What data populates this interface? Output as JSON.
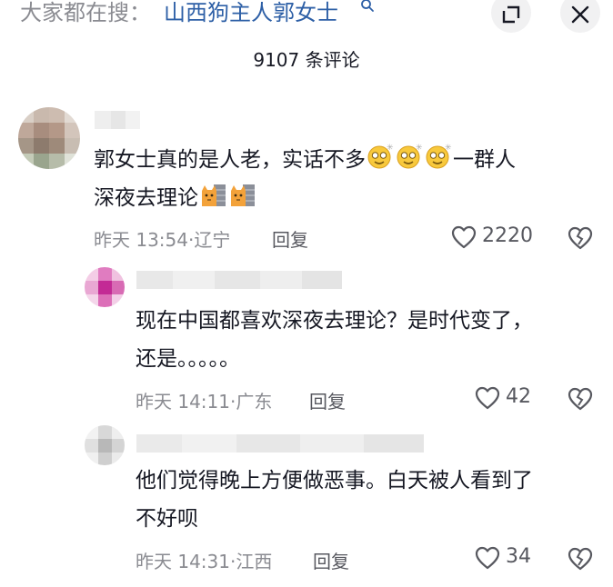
{
  "header": {
    "search_prefix": "大家都在搜：",
    "search_term": "山西狗主人郭女士",
    "expand_button": "expand-icon",
    "close_button": "close-icon"
  },
  "comments_count_label": "9107 条评论",
  "comments": [
    {
      "text_line1": "郭女士真的是人老，实话不多",
      "text_line1_tail": "一群人",
      "text_line2": "深夜去理论",
      "emojis": [
        "dizzy-face-emoji",
        "dizzy-face-emoji",
        "dizzy-face-emoji",
        "cat-wall-emoji",
        "cat-wall-emoji"
      ],
      "time": "昨天 13:54",
      "location": "辽宁",
      "reply_label": "回复",
      "likes": "2220"
    },
    {
      "text_line1": "现在中国都喜欢深夜去理论？是时代变了，",
      "text_line2": "还是。。。。。",
      "time": "昨天 14:11",
      "location": "广东",
      "reply_label": "回复",
      "likes": "42"
    },
    {
      "text_line1": "他们觉得晚上方便做恶事。白天被人看到了",
      "text_line2": "不好呗",
      "time": "昨天 14:31",
      "location": "江西",
      "reply_label": "回复",
      "likes": "34"
    }
  ],
  "colors": {
    "text_primary": "#161823",
    "text_secondary": "#8a8b91",
    "link_blue": "#2d5fa6",
    "button_bg": "#f1f1f2"
  }
}
